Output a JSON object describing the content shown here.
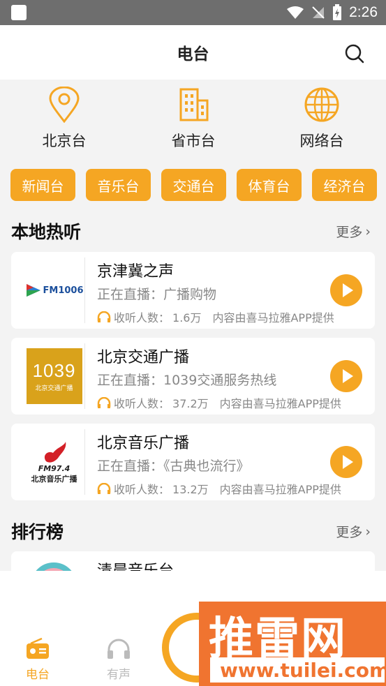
{
  "status_bar": {
    "time": "2:26"
  },
  "header": {
    "title": "电台"
  },
  "categories": [
    {
      "label": "北京台",
      "icon": "location-pin-icon"
    },
    {
      "label": "省市台",
      "icon": "building-icon"
    },
    {
      "label": "网络台",
      "icon": "globe-icon"
    }
  ],
  "pills": [
    "新闻台",
    "音乐台",
    "交通台",
    "体育台",
    "经济台"
  ],
  "local_hot": {
    "title": "本地热听",
    "more": "更多",
    "items": [
      {
        "name": "京津冀之声",
        "live": "正在直播：广播购物",
        "listeners_label": "收听人数：",
        "listeners": "1.6万",
        "source": "内容由喜马拉雅APP提供",
        "logo_text": "FM1006"
      },
      {
        "name": "北京交通广播",
        "live": "正在直播：1039交通服务热线",
        "listeners_label": "收听人数：",
        "listeners": "37.2万",
        "source": "内容由喜马拉雅APP提供",
        "logo_text": "1039",
        "logo_sub": "北京交通广播"
      },
      {
        "name": "北京音乐广播",
        "live": "正在直播：《古典也流行》",
        "listeners_label": "收听人数：",
        "listeners": "13.2万",
        "source": "内容由喜马拉雅APP提供",
        "logo_text": "FM97.4",
        "logo_sub": "北京音乐广播"
      }
    ]
  },
  "ranking": {
    "title": "排行榜",
    "more": "更多",
    "first_item": "清晨音乐台"
  },
  "tabs": [
    {
      "label": "电台",
      "active": true
    },
    {
      "label": "有声",
      "active": false
    }
  ],
  "watermark": {
    "text": "推雷网",
    "url": "www.tuilei.com"
  },
  "colors": {
    "accent": "#f5a623",
    "watermark": "#f07430"
  }
}
